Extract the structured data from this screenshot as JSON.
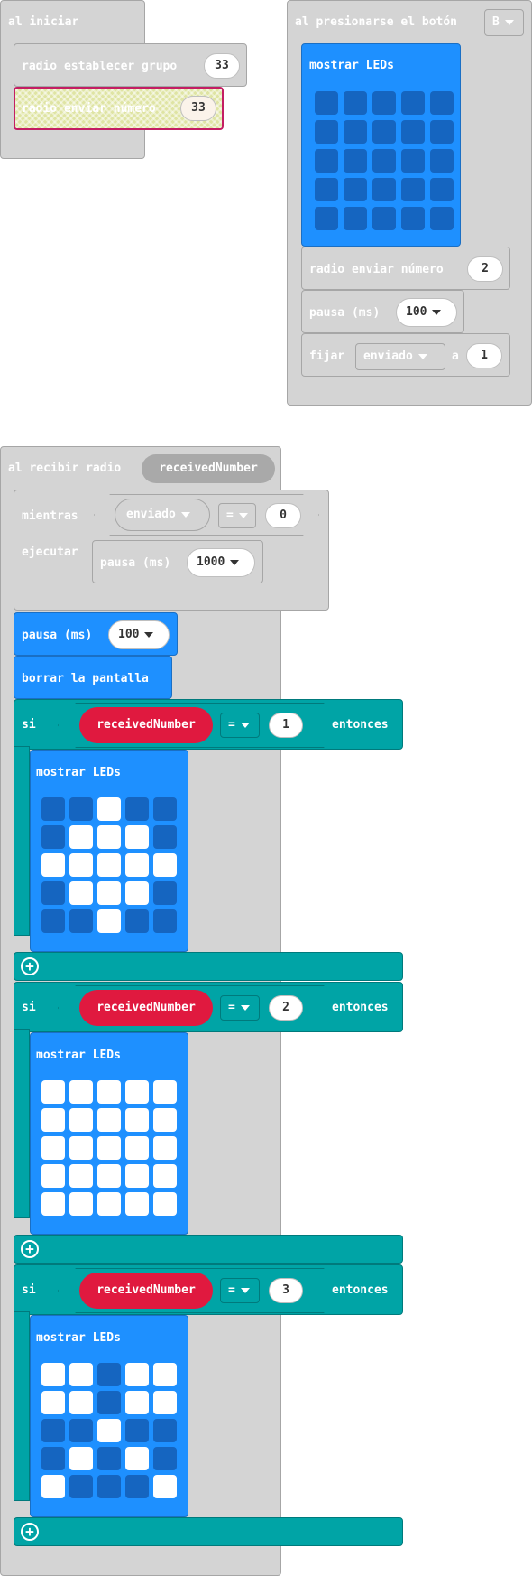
{
  "on_start": {
    "label": "al iniciar",
    "set_group": {
      "label": "radio establecer grupo",
      "value": "33"
    },
    "send_number": {
      "label": "radio enviar número",
      "value": "33"
    }
  },
  "button_event": {
    "label": "al presionarse el botón",
    "button": "B",
    "show_leds": {
      "label": "mostrar LEDs",
      "grid": [
        [
          0,
          0,
          0,
          0,
          0
        ],
        [
          0,
          0,
          0,
          0,
          0
        ],
        [
          0,
          0,
          0,
          0,
          0
        ],
        [
          0,
          0,
          0,
          0,
          0
        ],
        [
          0,
          0,
          0,
          0,
          0
        ]
      ]
    },
    "send_number": {
      "label": "radio enviar número",
      "value": "2"
    },
    "pause": {
      "label": "pausa (ms)",
      "value": "100"
    },
    "set_var": {
      "label": "fijar",
      "var": "enviado",
      "to": "a",
      "value": "1"
    }
  },
  "received": {
    "label": "al recibir radio",
    "param": "receivedNumber",
    "while": {
      "label": "mientras",
      "var": "enviado",
      "op": "=",
      "value": "0",
      "do": "ejecutar",
      "pause": {
        "label": "pausa (ms)",
        "value": "1000"
      }
    },
    "pause": {
      "label": "pausa (ms)",
      "value": "100"
    },
    "clear": "borrar la pantalla",
    "ifs": [
      {
        "label": "si",
        "var": "receivedNumber",
        "op": "=",
        "value": "1",
        "then": "entonces",
        "leds_label": "mostrar LEDs",
        "grid": [
          [
            0,
            0,
            1,
            0,
            0
          ],
          [
            0,
            1,
            1,
            1,
            0
          ],
          [
            1,
            1,
            1,
            1,
            1
          ],
          [
            0,
            1,
            1,
            1,
            0
          ],
          [
            0,
            0,
            1,
            0,
            0
          ]
        ]
      },
      {
        "label": "si",
        "var": "receivedNumber",
        "op": "=",
        "value": "2",
        "then": "entonces",
        "leds_label": "mostrar LEDs",
        "grid": [
          [
            1,
            1,
            1,
            1,
            1
          ],
          [
            1,
            1,
            1,
            1,
            1
          ],
          [
            1,
            1,
            1,
            1,
            1
          ],
          [
            1,
            1,
            1,
            1,
            1
          ],
          [
            1,
            1,
            1,
            1,
            1
          ]
        ]
      },
      {
        "label": "si",
        "var": "receivedNumber",
        "op": "=",
        "value": "3",
        "then": "entonces",
        "leds_label": "mostrar LEDs",
        "grid": [
          [
            1,
            1,
            0,
            1,
            1
          ],
          [
            1,
            1,
            0,
            1,
            1
          ],
          [
            0,
            0,
            1,
            0,
            0
          ],
          [
            0,
            1,
            0,
            1,
            0
          ],
          [
            1,
            0,
            0,
            0,
            1
          ]
        ]
      }
    ]
  },
  "colors": {
    "gray": "#d4d4d4",
    "blue": "#1e90ff",
    "teal": "#00a4a6",
    "red": "#e0193f",
    "led_on": "#ffffff",
    "led_off": "#1565c0"
  }
}
